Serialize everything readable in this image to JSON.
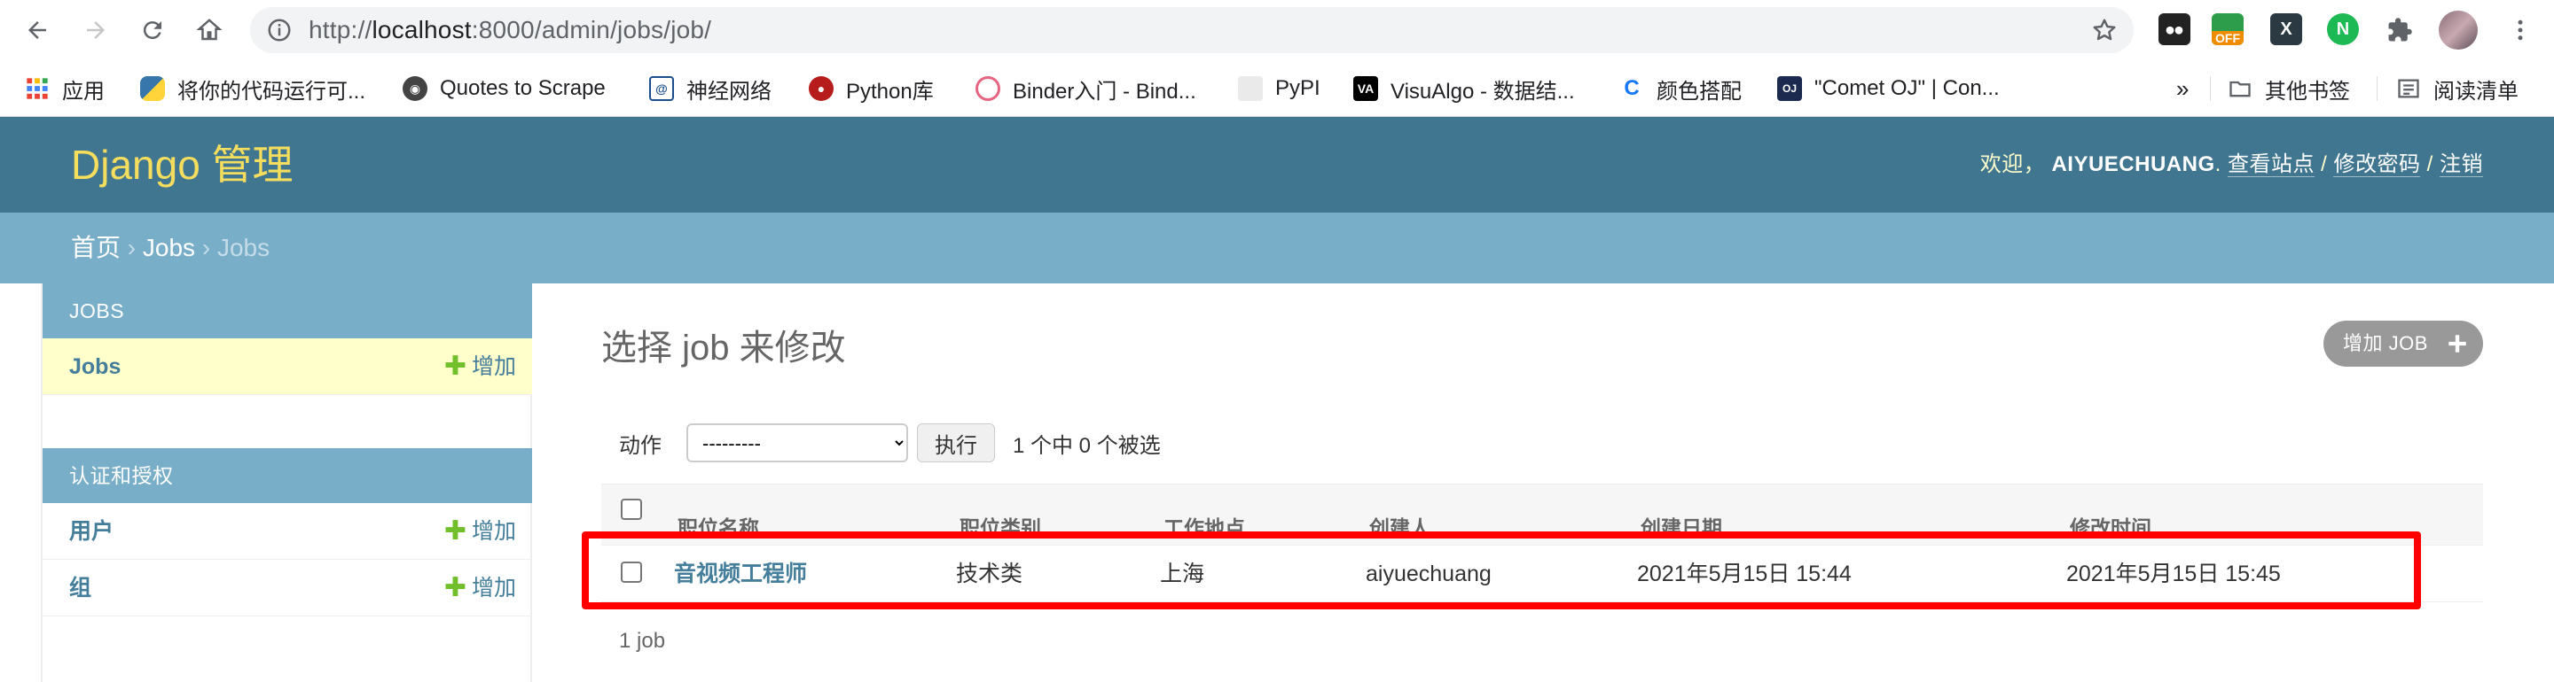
{
  "browser": {
    "url_scheme": "http://",
    "url_host": "localhost",
    "url_rest": ":8000/admin/jobs/job/",
    "extensions": [
      {
        "name": "tampermonkey-icon",
        "label": "",
        "color": "#222222"
      },
      {
        "name": "off-extension-icon",
        "label": "OFF",
        "color": "#f08c00"
      },
      {
        "name": "x-extension-icon",
        "label": "X",
        "color": "#2b3a42"
      },
      {
        "name": "n-extension-icon",
        "label": "N",
        "color": "#1db954"
      }
    ]
  },
  "bookmarks": [
    {
      "label": "应用",
      "icon": "apps-grid-icon"
    },
    {
      "label": "将你的代码运行可...",
      "icon": "python-icon"
    },
    {
      "label": "Quotes to Scrape",
      "icon": "globe-icon"
    },
    {
      "label": "神经网络",
      "icon": "spiral-icon"
    },
    {
      "label": "Python库",
      "icon": "python-lib-icon"
    },
    {
      "label": "Binder入门 - Bind...",
      "icon": "binder-icon"
    },
    {
      "label": "PyPI",
      "icon": "pypi-icon"
    },
    {
      "label": "VisuAlgo - 数据结...",
      "icon": "visualgo-icon"
    },
    {
      "label": "颜色搭配",
      "icon": "color-icon"
    },
    {
      "label": "\"Comet OJ\" | Con...",
      "icon": "cometoj-icon"
    },
    {
      "label": "»",
      "icon": ""
    },
    {
      "label": "其他书签",
      "icon": "folder-icon"
    },
    {
      "label": "阅读清单",
      "icon": "reading-list-icon"
    }
  ],
  "header": {
    "brand": "Django 管理",
    "welcome": "欢迎，",
    "username": "AIYUECHUANG",
    "view_site": "查看站点",
    "change_password": "修改密码",
    "logout": "注销",
    "sep1": ". ",
    "sep2": " / ",
    "sep3": " / "
  },
  "breadcrumbs": {
    "home": "首页",
    "sep": " › ",
    "app": "Jobs",
    "current": "Jobs"
  },
  "sidebar": {
    "modules": [
      {
        "caption": "JOBS",
        "rows": [
          {
            "name": "Jobs",
            "add": "增加",
            "current": true
          }
        ]
      },
      {
        "caption": "认证和授权",
        "rows": [
          {
            "name": "用户",
            "add": "增加",
            "current": false
          },
          {
            "name": "组",
            "add": "增加",
            "current": false
          }
        ]
      }
    ],
    "add_plus": "✚"
  },
  "content": {
    "title": "选择 job 来修改",
    "add_button": "增加 JOB",
    "action_label": "动作",
    "action_selected": "---------",
    "go_button": "执行",
    "counter": "1 个中 0 个被选",
    "columns": [
      "职位名称",
      "职位类别",
      "工作地点",
      "创建人",
      "创建日期",
      "修改时间"
    ],
    "rows": [
      {
        "job_name": "音视频工程师",
        "job_type": "技术类",
        "location": "上海",
        "creator": "aiyuechuang",
        "created": "2021年5月15日 15:44",
        "modified": "2021年5月15日 15:45"
      }
    ],
    "paginator": "1 job"
  },
  "colors": {
    "header_bg": "#417690",
    "brand": "#f5dd5d",
    "breadcrumb_bg": "#79aec8",
    "link": "#447e9b",
    "add_green": "#70bf2b",
    "current_row": "#ffffcc",
    "highlight": "#ff0000"
  }
}
